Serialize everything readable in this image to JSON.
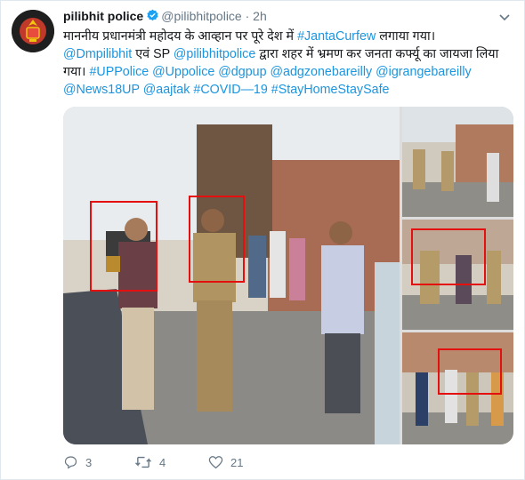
{
  "account": {
    "display_name": "pilibhit police",
    "handle": "@pilibhitpolice",
    "separator": "·",
    "time": "2h"
  },
  "tweet": {
    "line1_text": "माननीय प्रधानमंत्री महोदय के आव्हान पर पूरे देश में ",
    "line1_link": "#JantaCurfew",
    "line1_tail": " लगाया गया।",
    "line2_link1": "@Dmpilibhit",
    "line2_mid": " एवं SP ",
    "line2_link2": "@pilibhitpolice",
    "line2_tail": " द्वारा शहर में भ्रमण कर जनता कर्फ्यू का जायजा लिया",
    "line3_text": "गया। ",
    "line3_links": "#UPPolice @Uppolice @dgpup @adgzonebareilly @igrangebareilly",
    "line4_links": "@News18UP @aajtak #COVID—19 #StayHomeStaySafe"
  },
  "actions": {
    "reply_count": "3",
    "retweet_count": "4",
    "like_count": "21"
  },
  "colors": {
    "link": "#1b95e0",
    "verified": "#1da1f2",
    "highlight_box": "#e41010",
    "muted": "#657786"
  }
}
